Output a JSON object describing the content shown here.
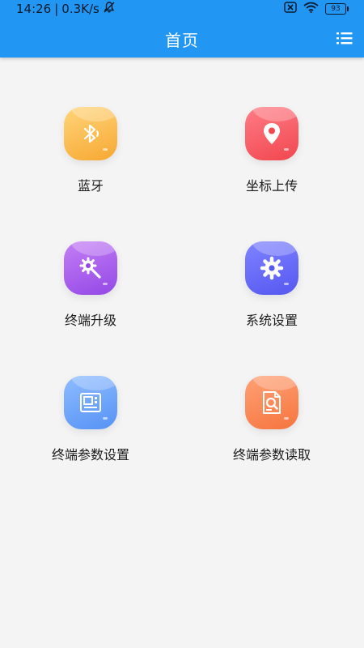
{
  "status_bar": {
    "time": "14:26",
    "network_speed": "0.3K/s",
    "battery": "93",
    "icons": [
      "mute-icon",
      "sim-off-icon",
      "wifi-icon",
      "battery-icon"
    ]
  },
  "app_bar": {
    "title": "首页",
    "menu_icon": "list-menu-icon",
    "background_color": "#2196f3"
  },
  "grid": {
    "items": [
      {
        "label": "蓝牙",
        "icon": "bluetooth-icon",
        "color_top": "#ffd57a",
        "color_bottom": "#f7a833"
      },
      {
        "label": "坐标上传",
        "icon": "location-pin-icon",
        "color_top": "#ff7c86",
        "color_bottom": "#f1474f"
      },
      {
        "label": "终端升级",
        "icon": "gear-wrench-icon",
        "color_top": "#c47ef5",
        "color_bottom": "#9348e6"
      },
      {
        "label": "系统设置",
        "icon": "gear-icon",
        "color_top": "#7f83ff",
        "color_bottom": "#5557f0"
      },
      {
        "label": "终端参数设置",
        "icon": "terminal-device-icon",
        "color_top": "#8fbcff",
        "color_bottom": "#5693f5"
      },
      {
        "label": "终端参数读取",
        "icon": "document-search-icon",
        "color_top": "#ffa175",
        "color_bottom": "#f6753f"
      }
    ]
  }
}
